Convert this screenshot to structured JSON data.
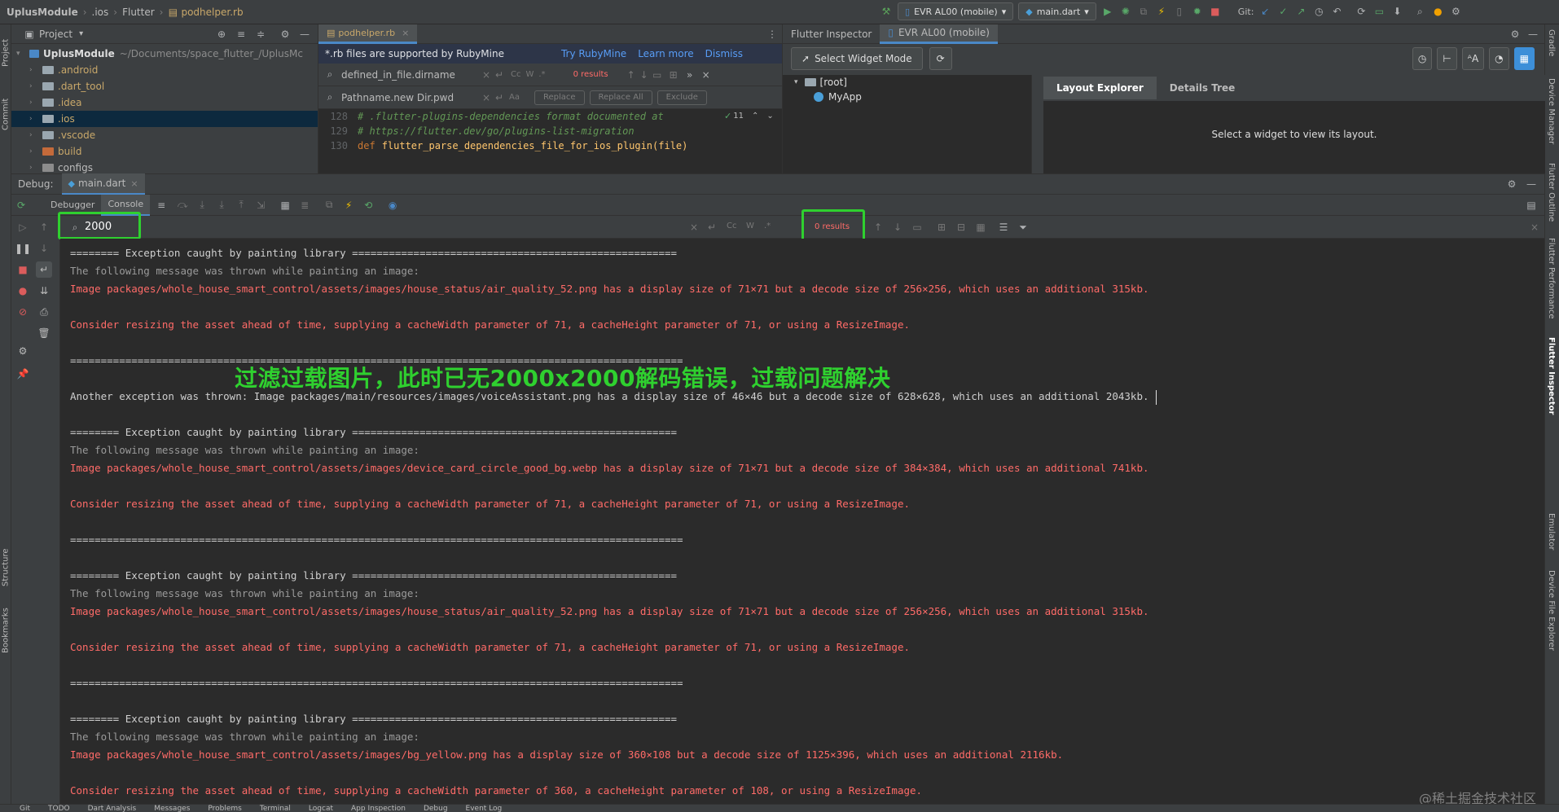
{
  "navbar": {
    "project": "UplusModule",
    "crumbs": [
      ".ios",
      "Flutter",
      "podhelper.rb"
    ],
    "device": "EVR AL00 (mobile)",
    "run_config": "main.dart",
    "git_label": "Git:"
  },
  "left_strip": {
    "project": "Project",
    "commit": "Commit",
    "structure": "Structure",
    "bookmarks": "Bookmarks"
  },
  "right_strip": {
    "gradle": "Gradle",
    "device_manager": "Device Manager",
    "flutter_outline": "Flutter Outline",
    "flutter_performance": "Flutter Performance",
    "flutter_inspector": "Flutter Inspector",
    "emulator": "Emulator",
    "device_file_explorer": "Device File Explorer"
  },
  "project_panel": {
    "title": "Project",
    "root_name": "UplusModule",
    "root_path": "~/Documents/space_flutter_/UplusMc",
    "items": [
      {
        "label": ".android",
        "color": "#c9a86a"
      },
      {
        "label": ".dart_tool",
        "color": "#c9a86a"
      },
      {
        "label": ".idea",
        "color": "#c9a86a"
      },
      {
        "label": ".ios",
        "color": "#c9a86a"
      },
      {
        "label": ".vscode",
        "color": "#c9a86a"
      },
      {
        "label": "build",
        "color": "#c9a86a"
      },
      {
        "label": "configs",
        "color": "#bbbbbb"
      }
    ]
  },
  "editor": {
    "tab": "podhelper.rb",
    "banner": {
      "text": "*.rb files are supported by RubyMine",
      "try": "Try RubyMine",
      "learn": "Learn more",
      "dismiss": "Dismiss"
    },
    "find": {
      "value": "defined_in_file.dirname",
      "results": "0 results"
    },
    "replace": {
      "value": "Pathname.new Dir.pwd",
      "replace": "Replace",
      "replace_all": "Replace All",
      "exclude": "Exclude"
    },
    "inspection_count": "11",
    "lines": [
      {
        "num": "128",
        "text": "# .flutter-plugins-dependencies format documented at"
      },
      {
        "num": "129",
        "text": "# https://flutter.dev/go/plugins-list-migration"
      },
      {
        "num": "130",
        "kw": "def",
        "text": "flutter_parse_dependencies_file_for_ios_plugin(file)"
      }
    ]
  },
  "inspector": {
    "tab_title": "Flutter Inspector",
    "device_tab": "EVR AL00 (mobile)",
    "select_mode": "Select Widget Mode",
    "tree_root": "[root]",
    "tree_child": "MyApp",
    "layout_tab": "Layout Explorer",
    "details_tab": "Details Tree",
    "empty_message": "Select a widget to view its layout."
  },
  "debug": {
    "label": "Debug:",
    "config": "main.dart",
    "tabs": [
      "Debugger",
      "Console"
    ],
    "search_value": "2000",
    "results": "0 results"
  },
  "overlay_text": "过滤过载图片，此时已无2000x2000解码错误，过载问题解决",
  "console_lines": [
    {
      "t": "w",
      "text": "======== Exception caught by painting library ====================================================="
    },
    {
      "t": "g",
      "text": "The following message was thrown while painting an image:"
    },
    {
      "t": "r",
      "text": "Image packages/whole_house_smart_control/assets/images/house_status/air_quality_52.png has a display size of 71×71 but a decode size of 256×256, which uses an additional 315kb."
    },
    {
      "t": "r",
      "text": ""
    },
    {
      "t": "r",
      "text": "Consider resizing the asset ahead of time, supplying a cacheWidth parameter of 71, a cacheHeight parameter of 71, or using a ResizeImage."
    },
    {
      "t": "w",
      "text": ""
    },
    {
      "t": "w",
      "text": "===================================================================================================="
    },
    {
      "t": "w",
      "text": ""
    },
    {
      "t": "w",
      "text": "Another exception was thrown: Image packages/main/resources/images/voiceAssistant.png has a display size of 46×46 but a decode size of 628×628, which uses an additional 2043kb."
    },
    {
      "t": "w",
      "text": ""
    },
    {
      "t": "w",
      "text": "======== Exception caught by painting library ====================================================="
    },
    {
      "t": "g",
      "text": "The following message was thrown while painting an image:"
    },
    {
      "t": "r",
      "text": "Image packages/whole_house_smart_control/assets/images/device_card_circle_good_bg.webp has a display size of 71×71 but a decode size of 384×384, which uses an additional 741kb."
    },
    {
      "t": "r",
      "text": ""
    },
    {
      "t": "r",
      "text": "Consider resizing the asset ahead of time, supplying a cacheWidth parameter of 71, a cacheHeight parameter of 71, or using a ResizeImage."
    },
    {
      "t": "w",
      "text": ""
    },
    {
      "t": "w",
      "text": "===================================================================================================="
    },
    {
      "t": "w",
      "text": ""
    },
    {
      "t": "w",
      "text": "======== Exception caught by painting library ====================================================="
    },
    {
      "t": "g",
      "text": "The following message was thrown while painting an image:"
    },
    {
      "t": "r",
      "text": "Image packages/whole_house_smart_control/assets/images/house_status/air_quality_52.png has a display size of 71×71 but a decode size of 256×256, which uses an additional 315kb."
    },
    {
      "t": "r",
      "text": ""
    },
    {
      "t": "r",
      "text": "Consider resizing the asset ahead of time, supplying a cacheWidth parameter of 71, a cacheHeight parameter of 71, or using a ResizeImage."
    },
    {
      "t": "w",
      "text": ""
    },
    {
      "t": "w",
      "text": "===================================================================================================="
    },
    {
      "t": "w",
      "text": ""
    },
    {
      "t": "w",
      "text": "======== Exception caught by painting library ====================================================="
    },
    {
      "t": "g",
      "text": "The following message was thrown while painting an image:"
    },
    {
      "t": "r",
      "text": "Image packages/whole_house_smart_control/assets/images/bg_yellow.png has a display size of 360×108 but a decode size of 1125×396, which uses an additional 2116kb."
    },
    {
      "t": "r",
      "text": ""
    },
    {
      "t": "r",
      "text": "Consider resizing the asset ahead of time, supplying a cacheWidth parameter of 360, a cacheHeight parameter of 108, or using a ResizeImage."
    }
  ],
  "bottom_tabs": [
    "Git",
    "TODO",
    "Dart Analysis",
    "Messages",
    "Problems",
    "Terminal",
    "Logcat",
    "App Inspection",
    "Debug",
    "Event Log"
  ],
  "watermark": "@稀土掘金技术社区",
  "colors": {
    "accent": "#4a88c7",
    "highlight": "#2fd02f",
    "error": "#ff6b68"
  }
}
